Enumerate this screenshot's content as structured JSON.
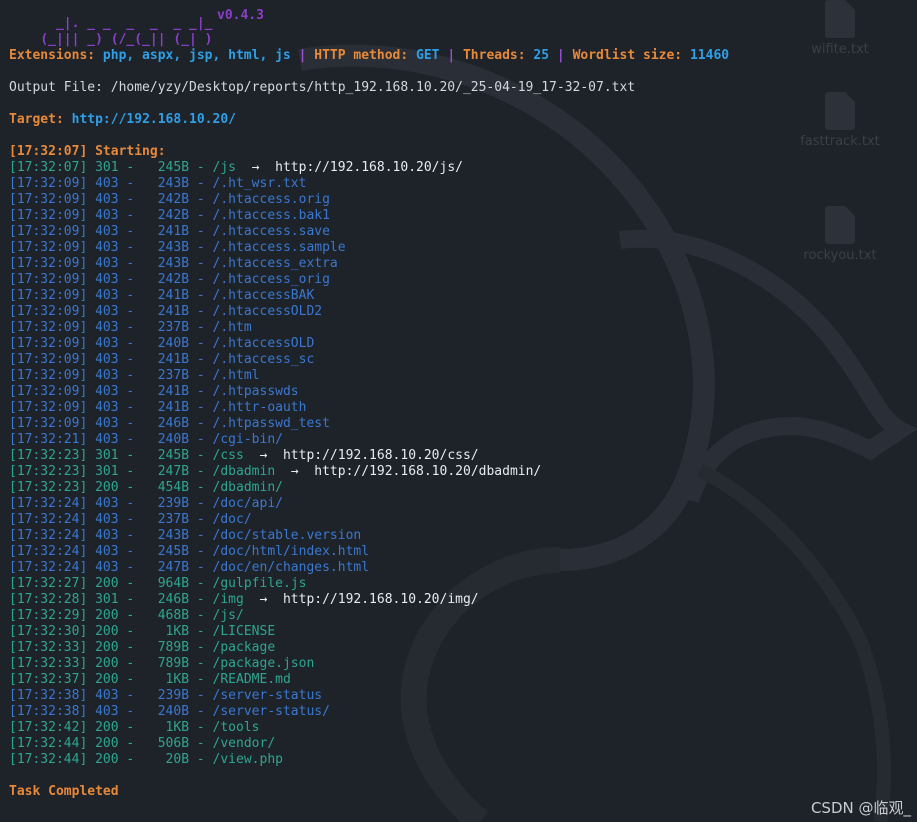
{
  "banner": {
    "art_line1": "  _|. _ _  _  _  _ _|_",
    "art_line2": "(_||| _) (/_(_|| (_| )",
    "version": "v0.4.3"
  },
  "config": {
    "extensions_key": "Extensions:",
    "extensions_val": "php, aspx, jsp, html, js",
    "method_key": "HTTP method:",
    "method_val": "GET",
    "threads_key": "Threads:",
    "threads_val": "25",
    "wordlist_key": "Wordlist size:",
    "wordlist_val": "11460",
    "separator": "|"
  },
  "output_file": "Output File: /home/yzy/Desktop/reports/http_192.168.10.20/_25-04-19_17-32-07.txt",
  "target": {
    "key": "Target:",
    "url": "http://192.168.10.20/"
  },
  "starting": "[17:32:07] Starting:",
  "results": [
    {
      "time": "[17:32:07]",
      "status": "301",
      "size": "  245B",
      "path": "/js",
      "redirect": "http://192.168.10.20/js/"
    },
    {
      "time": "[17:32:09]",
      "status": "403",
      "size": "  243B",
      "path": "/.ht_wsr.txt",
      "redirect": ""
    },
    {
      "time": "[17:32:09]",
      "status": "403",
      "size": "  242B",
      "path": "/.htaccess.orig",
      "redirect": ""
    },
    {
      "time": "[17:32:09]",
      "status": "403",
      "size": "  242B",
      "path": "/.htaccess.bak1",
      "redirect": ""
    },
    {
      "time": "[17:32:09]",
      "status": "403",
      "size": "  241B",
      "path": "/.htaccess.save",
      "redirect": ""
    },
    {
      "time": "[17:32:09]",
      "status": "403",
      "size": "  243B",
      "path": "/.htaccess.sample",
      "redirect": ""
    },
    {
      "time": "[17:32:09]",
      "status": "403",
      "size": "  243B",
      "path": "/.htaccess_extra",
      "redirect": ""
    },
    {
      "time": "[17:32:09]",
      "status": "403",
      "size": "  242B",
      "path": "/.htaccess_orig",
      "redirect": ""
    },
    {
      "time": "[17:32:09]",
      "status": "403",
      "size": "  241B",
      "path": "/.htaccessBAK",
      "redirect": ""
    },
    {
      "time": "[17:32:09]",
      "status": "403",
      "size": "  241B",
      "path": "/.htaccessOLD2",
      "redirect": ""
    },
    {
      "time": "[17:32:09]",
      "status": "403",
      "size": "  237B",
      "path": "/.htm",
      "redirect": ""
    },
    {
      "time": "[17:32:09]",
      "status": "403",
      "size": "  240B",
      "path": "/.htaccessOLD",
      "redirect": ""
    },
    {
      "time": "[17:32:09]",
      "status": "403",
      "size": "  241B",
      "path": "/.htaccess_sc",
      "redirect": ""
    },
    {
      "time": "[17:32:09]",
      "status": "403",
      "size": "  237B",
      "path": "/.html",
      "redirect": ""
    },
    {
      "time": "[17:32:09]",
      "status": "403",
      "size": "  241B",
      "path": "/.htpasswds",
      "redirect": ""
    },
    {
      "time": "[17:32:09]",
      "status": "403",
      "size": "  241B",
      "path": "/.httr-oauth",
      "redirect": ""
    },
    {
      "time": "[17:32:09]",
      "status": "403",
      "size": "  246B",
      "path": "/.htpasswd_test",
      "redirect": ""
    },
    {
      "time": "[17:32:21]",
      "status": "403",
      "size": "  240B",
      "path": "/cgi-bin/",
      "redirect": ""
    },
    {
      "time": "[17:32:23]",
      "status": "301",
      "size": "  245B",
      "path": "/css",
      "redirect": "http://192.168.10.20/css/"
    },
    {
      "time": "[17:32:23]",
      "status": "301",
      "size": "  247B",
      "path": "/dbadmin",
      "redirect": "http://192.168.10.20/dbadmin/"
    },
    {
      "time": "[17:32:23]",
      "status": "200",
      "size": "  454B",
      "path": "/dbadmin/",
      "redirect": ""
    },
    {
      "time": "[17:32:24]",
      "status": "403",
      "size": "  239B",
      "path": "/doc/api/",
      "redirect": ""
    },
    {
      "time": "[17:32:24]",
      "status": "403",
      "size": "  237B",
      "path": "/doc/",
      "redirect": ""
    },
    {
      "time": "[17:32:24]",
      "status": "403",
      "size": "  243B",
      "path": "/doc/stable.version",
      "redirect": ""
    },
    {
      "time": "[17:32:24]",
      "status": "403",
      "size": "  245B",
      "path": "/doc/html/index.html",
      "redirect": ""
    },
    {
      "time": "[17:32:24]",
      "status": "403",
      "size": "  247B",
      "path": "/doc/en/changes.html",
      "redirect": ""
    },
    {
      "time": "[17:32:27]",
      "status": "200",
      "size": "  964B",
      "path": "/gulpfile.js",
      "redirect": ""
    },
    {
      "time": "[17:32:28]",
      "status": "301",
      "size": "  246B",
      "path": "/img",
      "redirect": "http://192.168.10.20/img/"
    },
    {
      "time": "[17:32:29]",
      "status": "200",
      "size": "  468B",
      "path": "/js/",
      "redirect": ""
    },
    {
      "time": "[17:32:30]",
      "status": "200",
      "size": "   1KB",
      "path": "/LICENSE",
      "redirect": ""
    },
    {
      "time": "[17:32:33]",
      "status": "200",
      "size": "  789B",
      "path": "/package",
      "redirect": ""
    },
    {
      "time": "[17:32:33]",
      "status": "200",
      "size": "  789B",
      "path": "/package.json",
      "redirect": ""
    },
    {
      "time": "[17:32:37]",
      "status": "200",
      "size": "   1KB",
      "path": "/README.md",
      "redirect": ""
    },
    {
      "time": "[17:32:38]",
      "status": "403",
      "size": "  239B",
      "path": "/server-status",
      "redirect": ""
    },
    {
      "time": "[17:32:38]",
      "status": "403",
      "size": "  240B",
      "path": "/server-status/",
      "redirect": ""
    },
    {
      "time": "[17:32:42]",
      "status": "200",
      "size": "   1KB",
      "path": "/tools",
      "redirect": ""
    },
    {
      "time": "[17:32:44]",
      "status": "200",
      "size": "  506B",
      "path": "/vendor/",
      "redirect": ""
    },
    {
      "time": "[17:32:44]",
      "status": "200",
      "size": "   20B",
      "path": "/view.php",
      "redirect": ""
    }
  ],
  "arrow": "→",
  "task_completed": "Task Completed",
  "desktop_icons": [
    "wifite.txt",
    "fasttrack.txt",
    "rockyou.txt"
  ],
  "watermark": "CSDN @临观_",
  "colors": {
    "background": "#1e2229",
    "accent_orange": "#e8893a",
    "accent_blue": "#2f9fe6",
    "banner_purple": "#8b3fc9",
    "status_403": "#3a78d0",
    "status_2xx_3xx": "#2ea68f"
  }
}
